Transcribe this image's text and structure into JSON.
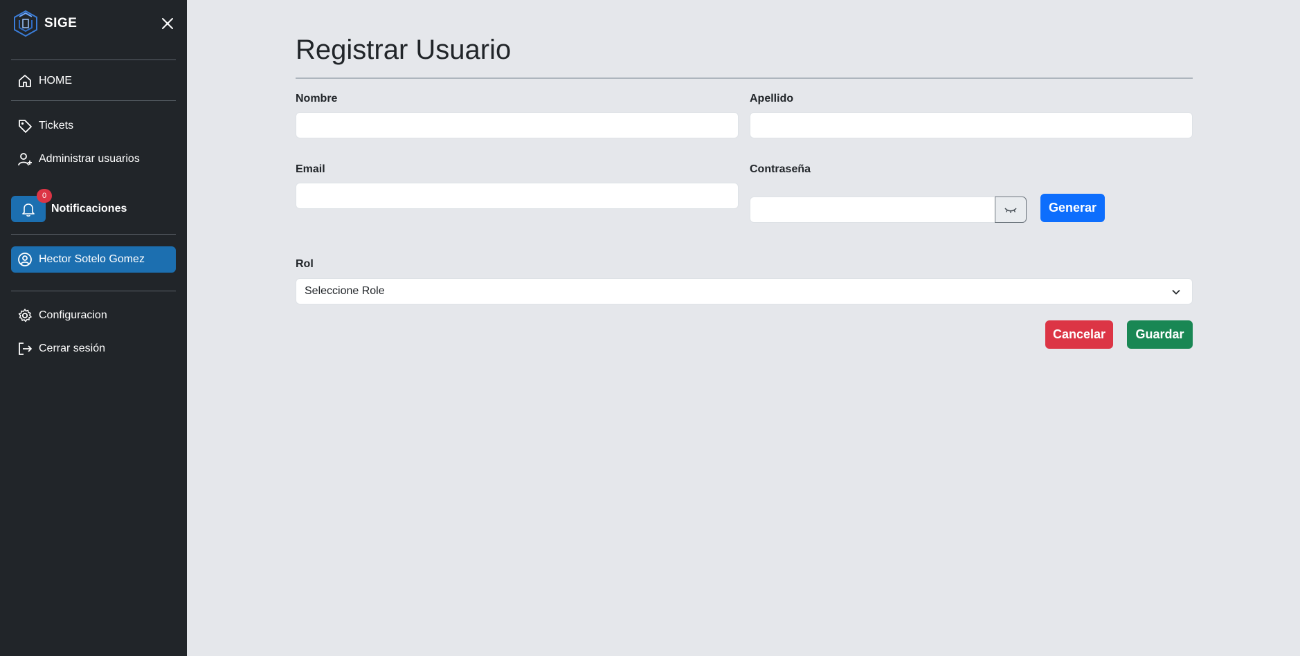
{
  "sidebar": {
    "brand": "SIGE",
    "nav": {
      "home": "HOME",
      "tickets": "Tickets",
      "admin_users": "Administrar usuarios",
      "user": "Hector Sotelo Gomez",
      "config": "Configuracion",
      "logout": "Cerrar sesión"
    },
    "notifications": {
      "label": "Notificaciones",
      "count": "0"
    }
  },
  "form": {
    "title": "Registrar Usuario",
    "nombre_label": "Nombre",
    "nombre_value": "",
    "apellido_label": "Apellido",
    "apellido_value": "",
    "email_label": "Email",
    "email_value": "",
    "password_label": "Contraseña",
    "password_value": "",
    "generate_label": "Generar",
    "role_label": "Rol",
    "role_selected": "Seleccione Role",
    "cancel_label": "Cancelar",
    "save_label": "Guardar"
  },
  "colors": {
    "sidebar_bg": "#212529",
    "active_bg": "#1c6fb0",
    "primary": "#0d6efd",
    "danger": "#dc3545",
    "success": "#198754",
    "page_bg": "#e5e7eb"
  },
  "icons": [
    "cube-logo-icon",
    "close-icon",
    "home-icon",
    "tag-icon",
    "user-plus-icon",
    "bell-icon",
    "user-circle-icon",
    "gear-icon",
    "logout-icon",
    "eye-slash-icon",
    "chevron-down-icon"
  ]
}
